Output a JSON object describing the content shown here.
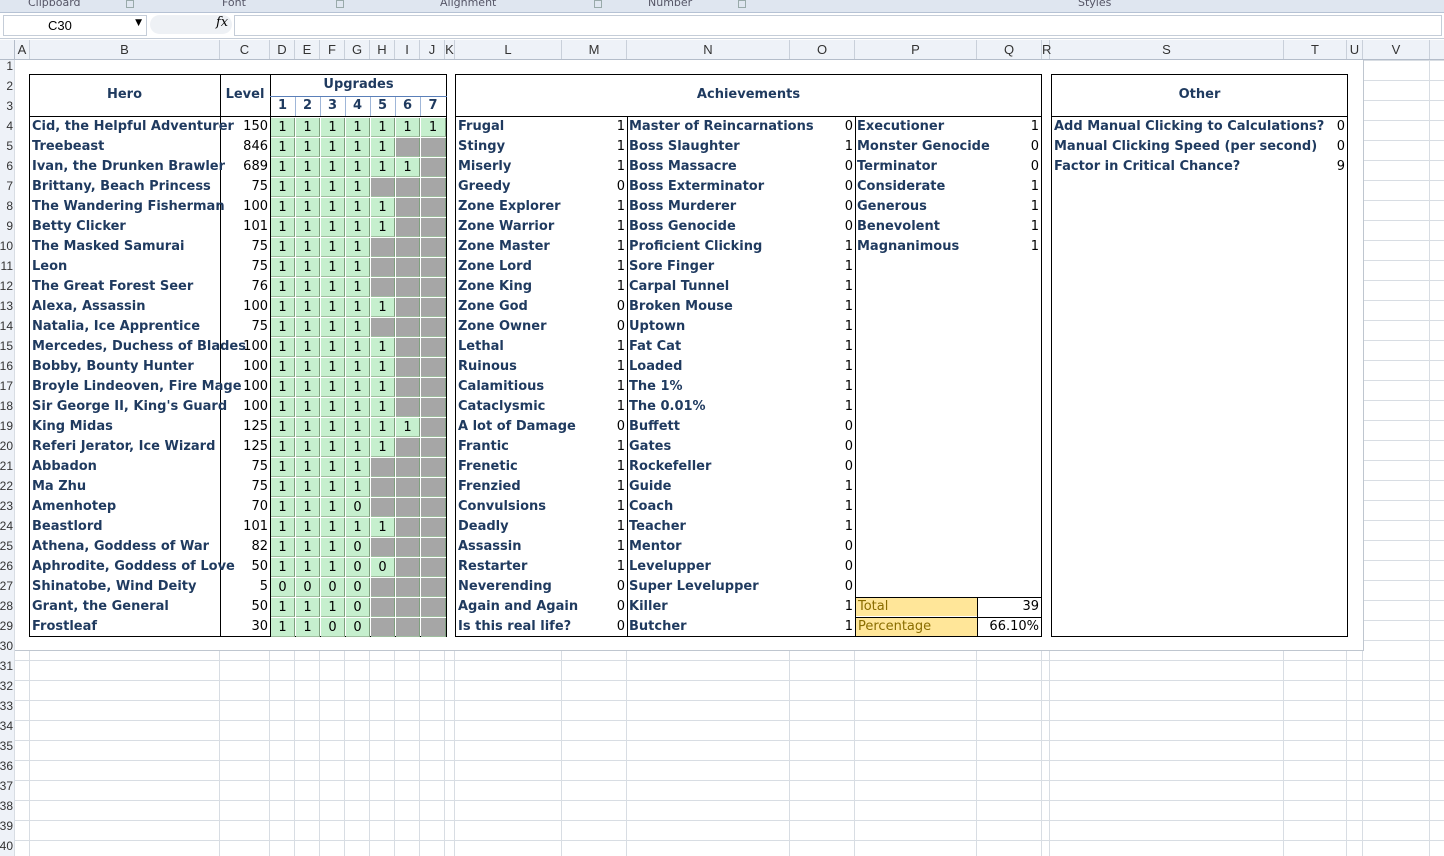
{
  "ribbon": {
    "groups": [
      "Clipboard",
      "Font",
      "Alignment",
      "Number",
      "Styles"
    ]
  },
  "formula_bar": {
    "name_box": "C30",
    "fx": "fx",
    "formula": ""
  },
  "columns": [
    "A",
    "B",
    "C",
    "D",
    "E",
    "F",
    "G",
    "H",
    "I",
    "J",
    "K",
    "L",
    "M",
    "N",
    "O",
    "P",
    "Q",
    "R",
    "S",
    "T",
    "U",
    "V"
  ],
  "rows": [
    "1",
    "2",
    "3",
    "4",
    "5",
    "6",
    "7",
    "8",
    "9",
    "10",
    "11",
    "12",
    "13",
    "14",
    "15",
    "16",
    "17",
    "18",
    "19",
    "20",
    "21",
    "22",
    "23",
    "24",
    "25",
    "26",
    "27",
    "28",
    "29",
    "30",
    "31",
    "32",
    "33",
    "34",
    "35",
    "36",
    "37",
    "38",
    "39",
    "40"
  ],
  "heroes": {
    "header_hero": "Hero",
    "header_level": "Level",
    "header_upgrades": "Upgrades",
    "upgrade_numbers": [
      "1",
      "2",
      "3",
      "4",
      "5",
      "6",
      "7"
    ],
    "rows": [
      {
        "name": "Cid, the Helpful Adventurer",
        "level": "150",
        "up": [
          "1",
          "1",
          "1",
          "1",
          "1",
          "1",
          "1"
        ]
      },
      {
        "name": "Treebeast",
        "level": "846",
        "up": [
          "1",
          "1",
          "1",
          "1",
          "1",
          "",
          ""
        ]
      },
      {
        "name": "Ivan, the Drunken Brawler",
        "level": "689",
        "up": [
          "1",
          "1",
          "1",
          "1",
          "1",
          "1",
          ""
        ]
      },
      {
        "name": "Brittany, Beach Princess",
        "level": "75",
        "up": [
          "1",
          "1",
          "1",
          "1",
          "",
          "",
          ""
        ]
      },
      {
        "name": "The Wandering Fisherman",
        "level": "100",
        "up": [
          "1",
          "1",
          "1",
          "1",
          "1",
          "",
          ""
        ]
      },
      {
        "name": "Betty Clicker",
        "level": "101",
        "up": [
          "1",
          "1",
          "1",
          "1",
          "1",
          "",
          ""
        ]
      },
      {
        "name": "The Masked Samurai",
        "level": "75",
        "up": [
          "1",
          "1",
          "1",
          "1",
          "",
          "",
          ""
        ]
      },
      {
        "name": "Leon",
        "level": "75",
        "up": [
          "1",
          "1",
          "1",
          "1",
          "",
          "",
          ""
        ]
      },
      {
        "name": "The Great Forest Seer",
        "level": "76",
        "up": [
          "1",
          "1",
          "1",
          "1",
          "",
          "",
          ""
        ]
      },
      {
        "name": "Alexa, Assassin",
        "level": "100",
        "up": [
          "1",
          "1",
          "1",
          "1",
          "1",
          "",
          ""
        ]
      },
      {
        "name": "Natalia, Ice Apprentice",
        "level": "75",
        "up": [
          "1",
          "1",
          "1",
          "1",
          "",
          "",
          ""
        ]
      },
      {
        "name": "Mercedes, Duchess of Blades",
        "level": "100",
        "up": [
          "1",
          "1",
          "1",
          "1",
          "1",
          "",
          ""
        ]
      },
      {
        "name": "Bobby, Bounty Hunter",
        "level": "100",
        "up": [
          "1",
          "1",
          "1",
          "1",
          "1",
          "",
          ""
        ]
      },
      {
        "name": "Broyle Lindeoven, Fire Mage",
        "level": "100",
        "up": [
          "1",
          "1",
          "1",
          "1",
          "1",
          "",
          ""
        ]
      },
      {
        "name": "Sir George II, King's Guard",
        "level": "100",
        "up": [
          "1",
          "1",
          "1",
          "1",
          "1",
          "",
          ""
        ]
      },
      {
        "name": "King Midas",
        "level": "125",
        "up": [
          "1",
          "1",
          "1",
          "1",
          "1",
          "1",
          ""
        ]
      },
      {
        "name": "Referi Jerator, Ice Wizard",
        "level": "125",
        "up": [
          "1",
          "1",
          "1",
          "1",
          "1",
          "",
          ""
        ]
      },
      {
        "name": "Abbadon",
        "level": "75",
        "up": [
          "1",
          "1",
          "1",
          "1",
          "",
          "",
          ""
        ]
      },
      {
        "name": "Ma Zhu",
        "level": "75",
        "up": [
          "1",
          "1",
          "1",
          "1",
          "",
          "",
          ""
        ]
      },
      {
        "name": "Amenhotep",
        "level": "70",
        "up": [
          "1",
          "1",
          "1",
          "0",
          "",
          "",
          ""
        ]
      },
      {
        "name": "Beastlord",
        "level": "101",
        "up": [
          "1",
          "1",
          "1",
          "1",
          "1",
          "",
          ""
        ]
      },
      {
        "name": "Athena, Goddess of War",
        "level": "82",
        "up": [
          "1",
          "1",
          "1",
          "0",
          "",
          "",
          ""
        ]
      },
      {
        "name": "Aphrodite, Goddess of Love",
        "level": "50",
        "up": [
          "1",
          "1",
          "1",
          "0",
          "0",
          "",
          ""
        ]
      },
      {
        "name": "Shinatobe, Wind Deity",
        "level": "5",
        "up": [
          "0",
          "0",
          "0",
          "0",
          "",
          "",
          ""
        ]
      },
      {
        "name": "Grant, the General",
        "level": "50",
        "up": [
          "1",
          "1",
          "1",
          "0",
          "",
          "",
          ""
        ]
      },
      {
        "name": "Frostleaf",
        "level": "30",
        "up": [
          "1",
          "1",
          "0",
          "0",
          "",
          "",
          ""
        ]
      }
    ]
  },
  "achievements": {
    "header": "Achievements",
    "col1": [
      {
        "name": "Frugal",
        "v": "1"
      },
      {
        "name": "Stingy",
        "v": "1"
      },
      {
        "name": "Miserly",
        "v": "1"
      },
      {
        "name": "Greedy",
        "v": "0"
      },
      {
        "name": "Zone Explorer",
        "v": "1"
      },
      {
        "name": "Zone Warrior",
        "v": "1"
      },
      {
        "name": "Zone Master",
        "v": "1"
      },
      {
        "name": "Zone Lord",
        "v": "1"
      },
      {
        "name": "Zone King",
        "v": "1"
      },
      {
        "name": "Zone God",
        "v": "0"
      },
      {
        "name": "Zone Owner",
        "v": "0"
      },
      {
        "name": "Lethal",
        "v": "1"
      },
      {
        "name": "Ruinous",
        "v": "1"
      },
      {
        "name": "Calamitious",
        "v": "1"
      },
      {
        "name": "Cataclysmic",
        "v": "1"
      },
      {
        "name": "A lot of Damage",
        "v": "0"
      },
      {
        "name": "Frantic",
        "v": "1"
      },
      {
        "name": "Frenetic",
        "v": "1"
      },
      {
        "name": "Frenzied",
        "v": "1"
      },
      {
        "name": "Convulsions",
        "v": "1"
      },
      {
        "name": "Deadly",
        "v": "1"
      },
      {
        "name": "Assassin",
        "v": "1"
      },
      {
        "name": "Restarter",
        "v": "1"
      },
      {
        "name": "Neverending",
        "v": "0"
      },
      {
        "name": "Again and Again",
        "v": "0"
      },
      {
        "name": "Is this real life?",
        "v": "0"
      }
    ],
    "col2": [
      {
        "name": "Master of Reincarnations",
        "v": "0"
      },
      {
        "name": "Boss Slaughter",
        "v": "1"
      },
      {
        "name": "Boss Massacre",
        "v": "0"
      },
      {
        "name": "Boss Exterminator",
        "v": "0"
      },
      {
        "name": "Boss Murderer",
        "v": "0"
      },
      {
        "name": "Boss Genocide",
        "v": "0"
      },
      {
        "name": "Proficient Clicking",
        "v": "1"
      },
      {
        "name": "Sore Finger",
        "v": "1"
      },
      {
        "name": "Carpal Tunnel",
        "v": "1"
      },
      {
        "name": "Broken Mouse",
        "v": "1"
      },
      {
        "name": "Uptown",
        "v": "1"
      },
      {
        "name": "Fat Cat",
        "v": "1"
      },
      {
        "name": "Loaded",
        "v": "1"
      },
      {
        "name": "The 1%",
        "v": "1"
      },
      {
        "name": "The 0.01%",
        "v": "1"
      },
      {
        "name": "Buffett",
        "v": "0"
      },
      {
        "name": "Gates",
        "v": "0"
      },
      {
        "name": "Rockefeller",
        "v": "0"
      },
      {
        "name": "Guide",
        "v": "1"
      },
      {
        "name": "Coach",
        "v": "1"
      },
      {
        "name": "Teacher",
        "v": "1"
      },
      {
        "name": "Mentor",
        "v": "0"
      },
      {
        "name": "Levelupper",
        "v": "0"
      },
      {
        "name": "Super Levelupper",
        "v": "0"
      },
      {
        "name": "Killer",
        "v": "1"
      },
      {
        "name": "Butcher",
        "v": "1"
      }
    ],
    "col3": [
      {
        "name": "Executioner",
        "v": "1"
      },
      {
        "name": "Monster Genocide",
        "v": "0"
      },
      {
        "name": "Terminator",
        "v": "0"
      },
      {
        "name": "Considerate",
        "v": "1"
      },
      {
        "name": "Generous",
        "v": "1"
      },
      {
        "name": "Benevolent",
        "v": "1"
      },
      {
        "name": "Magnanimous",
        "v": "1"
      }
    ],
    "total_label": "Total",
    "total_value": "39",
    "percentage_label": "Percentage",
    "percentage_value": "66.10%"
  },
  "other": {
    "header": "Other",
    "rows": [
      {
        "name": "Add Manual Clicking to Calculations?",
        "v": "0"
      },
      {
        "name": "Manual Clicking Speed (per second)",
        "v": "0"
      },
      {
        "name": "Factor in Critical Chance?",
        "v": "9"
      }
    ]
  },
  "colors": {
    "upgrade_done": "#c6efce",
    "upgrade_na": "#a6a6a6",
    "summary_fill": "#ffe699",
    "header_text": "#1f3a5f"
  }
}
